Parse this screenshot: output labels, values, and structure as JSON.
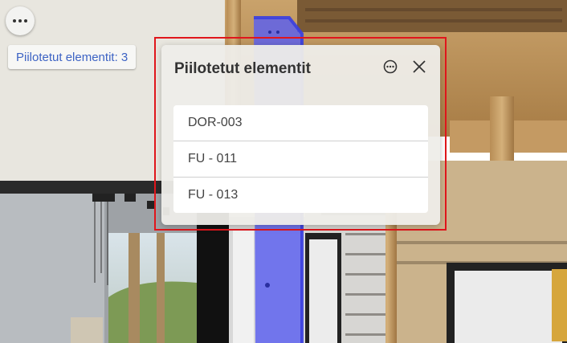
{
  "toolbar": {
    "menu_icon": "more-horizontal-icon",
    "hidden_chip_label": "Piilotetut elementit: 3"
  },
  "panel": {
    "title": "Piilotetut elementit",
    "options_icon": "more-circle-icon",
    "close_icon": "close-icon",
    "items": [
      {
        "label": "DOR-003"
      },
      {
        "label": "FU - 011"
      },
      {
        "label": "FU - 013"
      }
    ]
  },
  "colors": {
    "accent_text": "#3d63c4",
    "highlight_border": "#e0161c",
    "selected_element": "#5a5ff0"
  }
}
